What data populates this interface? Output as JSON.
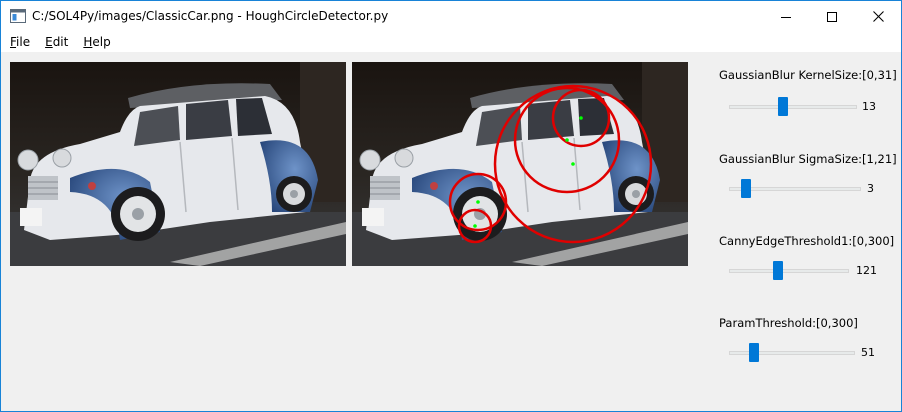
{
  "window": {
    "title": "C:/SOL4Py/images/ClassicCar.png - HoughCircleDetector.py"
  },
  "menu": {
    "file": {
      "accel": "F",
      "rest": "ile"
    },
    "edit": {
      "accel": "E",
      "rest": "dit"
    },
    "help": {
      "accel": "H",
      "rest": "elp"
    }
  },
  "colors": {
    "accent": "#0078d7",
    "circle": "#e00000",
    "center": "#00ff00"
  },
  "sliders": [
    {
      "label": "GaussianBlur KernelSize:[0,31]",
      "value": "13",
      "fraction": 0.419
    },
    {
      "label": "GaussianBlur SigmaSize:[1,21]",
      "value": "3",
      "fraction": 0.1
    },
    {
      "label": "CannyEdgeThreshold1:[0,300]",
      "value": "121",
      "fraction": 0.403
    },
    {
      "label": "ParamThreshold:[0,300]",
      "value": "51",
      "fraction": 0.17
    }
  ]
}
